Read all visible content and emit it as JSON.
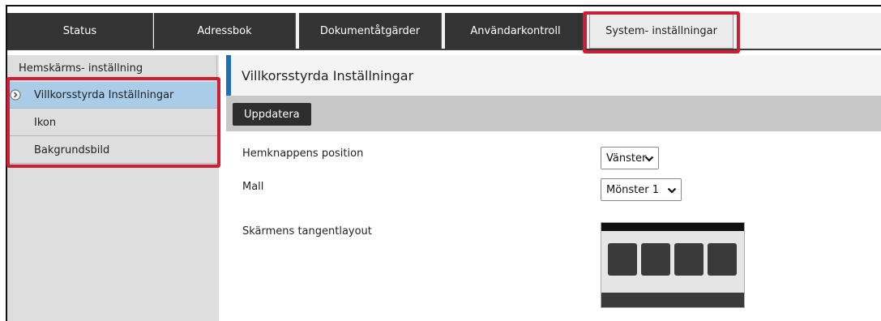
{
  "tabs": [
    {
      "label": "Status",
      "active": false
    },
    {
      "label": "Adressbok",
      "active": false
    },
    {
      "label": "Dokumentåtgärder",
      "active": false
    },
    {
      "label": "Användarkontroll",
      "active": false
    },
    {
      "label": "System- inställningar",
      "active": true
    }
  ],
  "sidebar": {
    "header": "Hemskärms- inställning",
    "items": [
      {
        "label": "Villkorsstyrda Inställningar",
        "selected": true,
        "icon": "circle-chevron-right-icon"
      },
      {
        "label": "Ikon",
        "selected": false
      },
      {
        "label": "Bakgrundsbild",
        "selected": false
      }
    ]
  },
  "main": {
    "title": "Villkorsstyrda Inställningar",
    "update_button": "Uppdatera",
    "settings": [
      {
        "label": "Hemknappens position",
        "value": "Vänster"
      },
      {
        "label": "Mall",
        "value": "Mönster 1"
      },
      {
        "label": "Skärmens tangentlayout"
      }
    ]
  },
  "colors": {
    "tab_background": "#333333",
    "highlight_outline": "#cc1f35",
    "selected_item": "#a9cde9",
    "title_accent": "#1e6fb5"
  }
}
